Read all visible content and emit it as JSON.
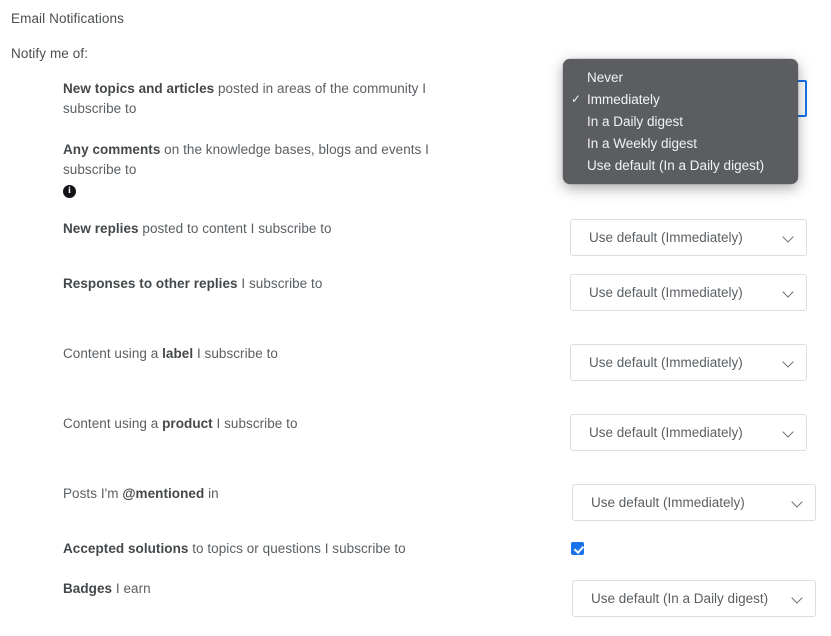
{
  "page": {
    "section_title": "Email Notifications",
    "notify_label": "Notify me of:"
  },
  "rows": [
    {
      "id": "new-topics-and-articles",
      "label_bold": "New topics and articles",
      "label_rest": " posted in areas of the community I subscribe to",
      "control": "select-open",
      "value": "Immediately"
    },
    {
      "id": "any-comments",
      "label_bold": "Any comments",
      "label_rest": " on the knowledge bases, blogs and events I subscribe to",
      "info_icon": "info-icon",
      "control": "select",
      "value": ""
    },
    {
      "id": "new-replies",
      "label_bold": "New replies",
      "label_rest": " posted to content I subscribe to",
      "control": "select",
      "value": "Use default (Immediately)"
    },
    {
      "id": "responses-to-other-replies",
      "label_bold": "Responses to other replies",
      "label_rest": " I subscribe to",
      "control": "select",
      "value": "Use default (Immediately)"
    },
    {
      "id": "content-using-a-label",
      "label_prefix": "Content using a ",
      "label_bold": "label",
      "label_rest": " I subscribe to",
      "control": "select",
      "value": "Use default (Immediately)"
    },
    {
      "id": "content-using-a-product",
      "label_prefix": "Content using a ",
      "label_bold": "product",
      "label_rest": " I subscribe to",
      "control": "select",
      "value": "Use default (Immediately)"
    },
    {
      "id": "posts-im-mentioned-in",
      "label_prefix": "Posts I'm ",
      "label_bold": "@mentioned",
      "label_rest": " in",
      "control": "select",
      "value": "Use default (Immediately)"
    },
    {
      "id": "accepted-solutions",
      "label_bold": "Accepted solutions",
      "label_rest": " to topics or questions I subscribe to",
      "control": "checkbox",
      "checked": true
    },
    {
      "id": "badges",
      "label_bold": "Badges",
      "label_rest": " I earn",
      "control": "select",
      "value": "Use default (In a Daily digest)"
    }
  ],
  "labels": {
    "new_topics_line": "New topics and articles posted in areas of the community I subscribe to",
    "new_topics_bold": "New topics and articles",
    "new_topics_rest": " posted in areas of the community I subscribe to",
    "any_comments_bold": "Any comments",
    "any_comments_rest": " on the knowledge bases, blogs and events I subscribe to",
    "new_replies_bold": "New replies",
    "new_replies_rest": " posted to content I subscribe to",
    "responses_bold": "Responses to other replies",
    "responses_rest": " I subscribe to",
    "label_prefix": "Content using a ",
    "label_bold": "label",
    "label_rest": " I subscribe to",
    "product_prefix": "Content using a ",
    "product_bold": "product",
    "product_rest": " I subscribe to",
    "mentioned_prefix": "Posts I'm ",
    "mentioned_bold": "@mentioned",
    "mentioned_rest": " in",
    "accepted_bold": "Accepted solutions",
    "accepted_rest": " to topics or questions I subscribe to",
    "badges_bold": "Badges",
    "badges_rest": " I earn"
  },
  "selects": {
    "new_replies_value": "Use default (Immediately)",
    "responses_value": "Use default (Immediately)",
    "label_value": "Use default (Immediately)",
    "product_value": "Use default (Immediately)",
    "mentioned_value": "Use default (Immediately)",
    "badges_value": "Use default (In a Daily digest)"
  },
  "dropdown": {
    "open": true,
    "selected": "Immediately",
    "check_glyph": "✓",
    "options": [
      {
        "label": "Never",
        "selected": false
      },
      {
        "label": "Immediately",
        "selected": true
      },
      {
        "label": "In a Daily digest",
        "selected": false
      },
      {
        "label": "In a Weekly digest",
        "selected": false
      },
      {
        "label": "Use default (In a Daily digest)",
        "selected": false
      }
    ]
  },
  "icons": {
    "info": "i",
    "chevron_down": "chevron-down-icon"
  },
  "colors": {
    "accent_blue": "#1a73e8",
    "menu_background": "#5b5d60",
    "menu_text": "#f2f3f4",
    "border": "#dcdfe2",
    "text": "#5a5f63",
    "text_bold": "#44484b"
  }
}
